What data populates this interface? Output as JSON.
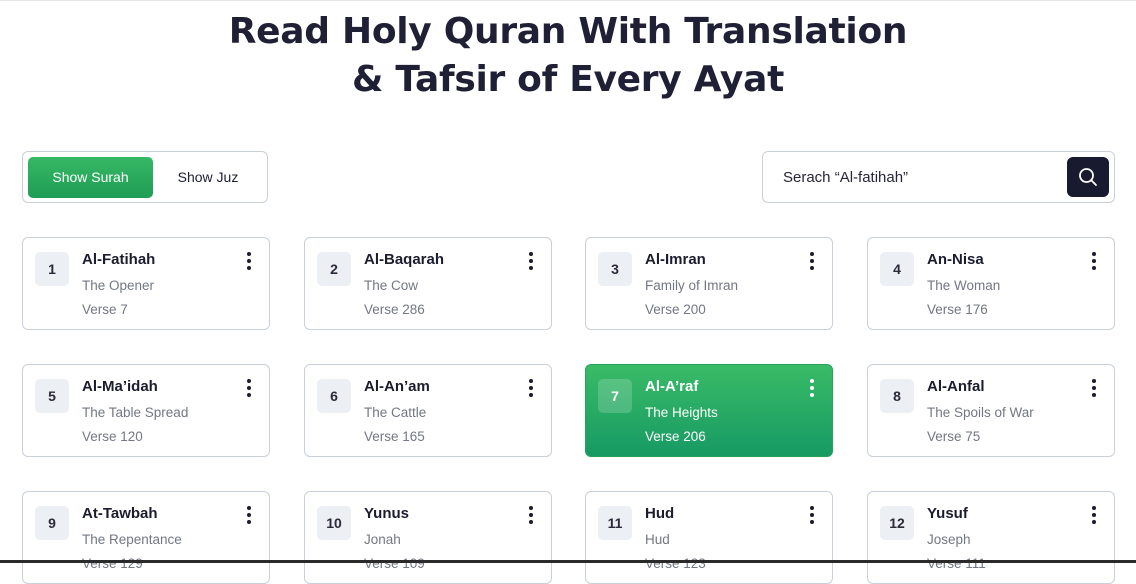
{
  "title": {
    "line1": "Read Holy Quran With Translation",
    "line2": "& Tafsir of Every Ayat"
  },
  "toggle": {
    "show_surah": "Show Surah",
    "show_juz": "Show Juz",
    "selected": "Show Surah"
  },
  "search": {
    "placeholder": "Serach “Al-fatihah”",
    "value": "",
    "icon": "search-icon"
  },
  "colors": {
    "accent_green": "#1f9d55",
    "search_button_dark": "#181b30"
  },
  "surahs": [
    {
      "number": "1",
      "name": "Al-Fatihah",
      "meaning": "The Opener",
      "verse": "Verse 7",
      "active": false
    },
    {
      "number": "2",
      "name": "Al-Baqarah",
      "meaning": "The Cow",
      "verse": "Verse 286",
      "active": false
    },
    {
      "number": "3",
      "name": "Al-Imran",
      "meaning": "Family of Imran",
      "verse": "Verse 200",
      "active": false
    },
    {
      "number": "4",
      "name": "An-Nisa",
      "meaning": "The Woman",
      "verse": "Verse 176",
      "active": false
    },
    {
      "number": "5",
      "name": "Al-Ma’idah",
      "meaning": "The Table Spread",
      "verse": "Verse 120",
      "active": false
    },
    {
      "number": "6",
      "name": "Al-An’am",
      "meaning": "The Cattle",
      "verse": "Verse 165",
      "active": false
    },
    {
      "number": "7",
      "name": "Al-A’raf",
      "meaning": "The Heights",
      "verse": "Verse 206",
      "active": true
    },
    {
      "number": "8",
      "name": "Al-Anfal",
      "meaning": "The Spoils of War",
      "verse": "Verse 75",
      "active": false
    },
    {
      "number": "9",
      "name": "At-Tawbah",
      "meaning": "The Repentance",
      "verse": "Verse 129",
      "active": false
    },
    {
      "number": "10",
      "name": "Yunus",
      "meaning": "Jonah",
      "verse": "Verse 109",
      "active": false
    },
    {
      "number": "11",
      "name": "Hud",
      "meaning": "Hud",
      "verse": "Verse 123",
      "active": false
    },
    {
      "number": "12",
      "name": "Yusuf",
      "meaning": "Joseph",
      "verse": "Verse 111",
      "active": false
    }
  ]
}
